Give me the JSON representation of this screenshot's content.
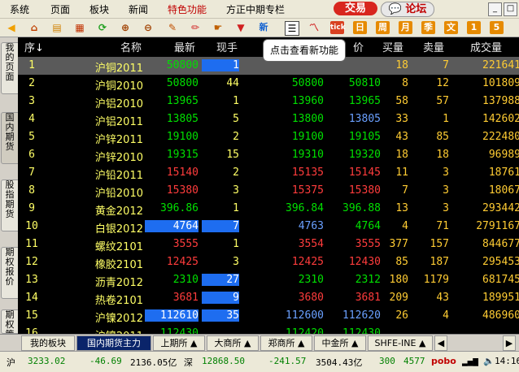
{
  "menu": {
    "items": [
      "系统",
      "页面",
      "板块",
      "新闻",
      "特色功能",
      "方正中期专栏"
    ],
    "trade": "交易",
    "forum": "论坛",
    "win_min": "_",
    "win_max": "□"
  },
  "toolbar": {
    "new_label": "新",
    "tick_label": "tick",
    "periods": [
      "日",
      "周",
      "月",
      "季",
      "文",
      "1",
      "5"
    ]
  },
  "tooltip": "点击查看新功能",
  "vtabs": [
    "我的页面",
    "国内期货",
    "股指期货",
    "期权报价",
    "期权策略"
  ],
  "grid": {
    "headers": [
      "序",
      "名称",
      "最新",
      "现手",
      "价",
      "买量",
      "卖量",
      "成交量"
    ],
    "sort_arrow": "↓",
    "rows": [
      {
        "seq": "1",
        "name": "沪铜2011",
        "last": "50800",
        "vol": "1",
        "bid": "",
        "ask": "",
        "buy": "18",
        "sell": "7",
        "total": "221641",
        "sel": true
      },
      {
        "seq": "2",
        "name": "沪铜2010",
        "last": "50800",
        "vol": "44",
        "bid": "50800",
        "ask": "50810",
        "buy": "8",
        "sell": "12",
        "total": "101809"
      },
      {
        "seq": "3",
        "name": "沪铝2010",
        "last": "13965",
        "vol": "1",
        "bid": "13960",
        "ask": "13965",
        "buy": "58",
        "sell": "57",
        "total": "137988"
      },
      {
        "seq": "4",
        "name": "沪铝2011",
        "last": "13805",
        "vol": "5",
        "bid": "13800",
        "ask": "13805",
        "buy": "33",
        "sell": "1",
        "total": "142602"
      },
      {
        "seq": "5",
        "name": "沪锌2011",
        "last": "19100",
        "vol": "2",
        "bid": "19100",
        "ask": "19105",
        "buy": "43",
        "sell": "85",
        "total": "222480"
      },
      {
        "seq": "6",
        "name": "沪锌2010",
        "last": "19315",
        "vol": "15",
        "bid": "19310",
        "ask": "19320",
        "buy": "18",
        "sell": "18",
        "total": "96989"
      },
      {
        "seq": "7",
        "name": "沪铅2011",
        "last": "15140",
        "vol": "2",
        "bid": "15135",
        "ask": "15145",
        "buy": "11",
        "sell": "3",
        "total": "18761"
      },
      {
        "seq": "8",
        "name": "沪铅2010",
        "last": "15380",
        "vol": "3",
        "bid": "15375",
        "ask": "15380",
        "buy": "7",
        "sell": "3",
        "total": "18067"
      },
      {
        "seq": "9",
        "name": "黄金2012",
        "last": "396.86",
        "vol": "1",
        "bid": "396.84",
        "ask": "396.88",
        "buy": "13",
        "sell": "3",
        "total": "293442"
      },
      {
        "seq": "10",
        "name": "白银2012",
        "last": "4764",
        "vol": "7",
        "bid": "4763",
        "ask": "4764",
        "buy": "4",
        "sell": "71",
        "total": "2791167"
      },
      {
        "seq": "11",
        "name": "螺纹2101",
        "last": "3555",
        "vol": "1",
        "bid": "3554",
        "ask": "3555",
        "buy": "377",
        "sell": "157",
        "total": "844677"
      },
      {
        "seq": "12",
        "name": "橡胶2101",
        "last": "12425",
        "vol": "3",
        "bid": "12425",
        "ask": "12430",
        "buy": "85",
        "sell": "187",
        "total": "295453"
      },
      {
        "seq": "13",
        "name": "沥青2012",
        "last": "2310",
        "vol": "27",
        "bid": "2310",
        "ask": "2312",
        "buy": "180",
        "sell": "1179",
        "total": "681745"
      },
      {
        "seq": "14",
        "name": "热卷2101",
        "last": "3681",
        "vol": "9",
        "bid": "3680",
        "ask": "3681",
        "buy": "209",
        "sell": "43",
        "total": "189951"
      },
      {
        "seq": "15",
        "name": "沪镍2012",
        "last": "112610",
        "vol": "35",
        "bid": "112600",
        "ask": "112620",
        "buy": "26",
        "sell": "4",
        "total": "486960"
      },
      {
        "seq": "16",
        "name": "沪镍2011",
        "last": "112430",
        "vol": "",
        "bid": "112420",
        "ask": "112430",
        "buy": "",
        "sell": "",
        "total": ""
      }
    ]
  },
  "bottom_tabs": [
    "我的板块",
    "国内期货主力",
    "上期所 ▲",
    "大商所 ▲",
    "郑商所 ▲",
    "中金所 ▲",
    "SHFE-INE ▲"
  ],
  "status": {
    "label1": "沪",
    "v1": "3233.02",
    "c1": "-46.69",
    "a1": "2136.05亿",
    "label2": "深",
    "v2": "12868.50",
    "c2": "-241.57",
    "a2": "3504.43亿",
    "v3": "300",
    "v4": "4577",
    "brand": "pobo",
    "time": "14:16"
  },
  "colors": {
    "up": "#ff3c3c",
    "down": "#00e000",
    "name": "#ffff66",
    "vol": "#ffff66",
    "buy": "#ffcc33",
    "sell": "#ffcc33",
    "total": "#ffcc33"
  }
}
